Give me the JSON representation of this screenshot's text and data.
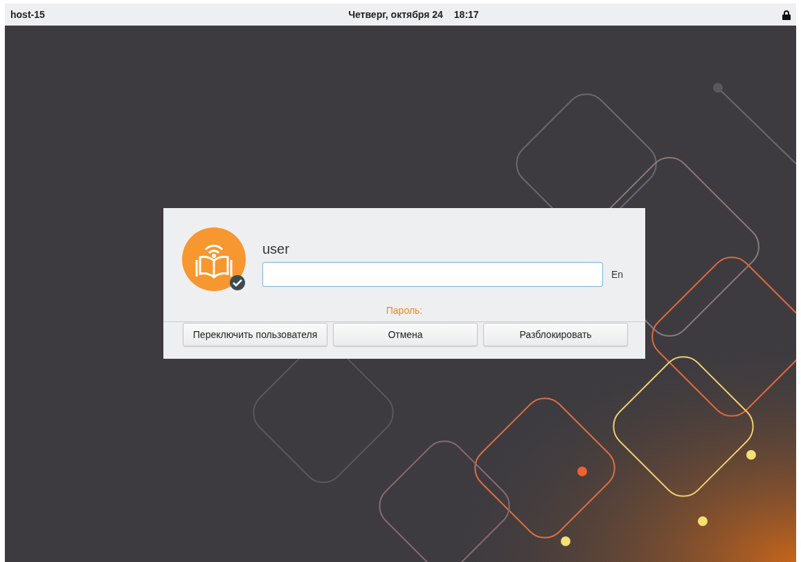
{
  "top_bar": {
    "hostname": "host-15",
    "date": "Четверг, октября 24",
    "time": "18:17"
  },
  "dialog": {
    "username": "user",
    "layout": "En",
    "prompt": "Пароль:",
    "buttons": [
      {
        "label": "Переключить пользователя"
      },
      {
        "label": "Отмена"
      },
      {
        "label": "Разблокировать"
      }
    ]
  }
}
